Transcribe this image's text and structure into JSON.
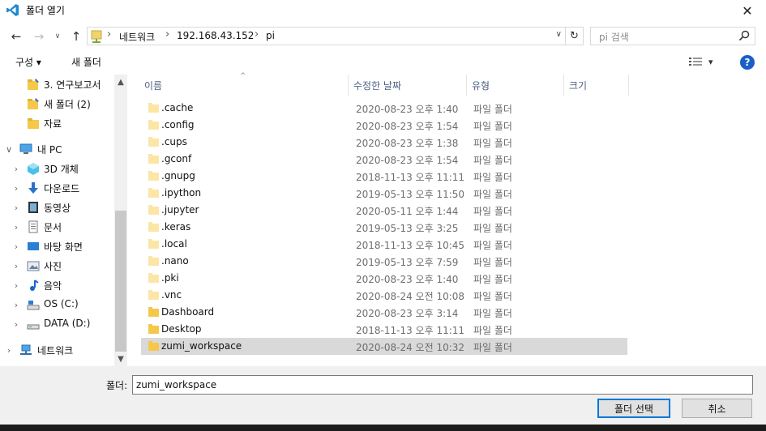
{
  "window": {
    "title": "폴더 열기",
    "close_glyph": "✕"
  },
  "nav": {
    "back_glyph": "←",
    "forward_glyph": "→",
    "recent_glyph": "∨",
    "up_glyph": "↑",
    "breadcrumbs": [
      "네트워크",
      "192.168.43.152",
      "pi"
    ],
    "separator": "›",
    "dropdown_glyph": "∨",
    "refresh_glyph": "↻",
    "search_placeholder": "pi 검색"
  },
  "toolbar": {
    "organize": "구성 ▾",
    "new_folder": "새 폴더",
    "view_glyph": "▾",
    "help": "?"
  },
  "sidebar": {
    "items": [
      {
        "label": "3. 연구보고서",
        "icon": "pinned-folder-icon",
        "level": 1,
        "chevron": ""
      },
      {
        "label": "새 폴더 (2)",
        "icon": "pinned-folder-icon",
        "level": 1,
        "chevron": ""
      },
      {
        "label": "자료",
        "icon": "folder-icon",
        "level": 1,
        "chevron": ""
      },
      {
        "label": "내 PC",
        "icon": "pc-icon",
        "level": 0,
        "chevron": "∨"
      },
      {
        "label": "3D 개체",
        "icon": "3d-objects-icon",
        "level": 1,
        "chevron": "›"
      },
      {
        "label": "다운로드",
        "icon": "download-icon",
        "level": 1,
        "chevron": "›"
      },
      {
        "label": "동영상",
        "icon": "video-icon",
        "level": 1,
        "chevron": "›"
      },
      {
        "label": "문서",
        "icon": "document-icon",
        "level": 1,
        "chevron": "›"
      },
      {
        "label": "바탕 화면",
        "icon": "desktop-icon",
        "level": 1,
        "chevron": "›"
      },
      {
        "label": "사진",
        "icon": "pictures-icon",
        "level": 1,
        "chevron": "›"
      },
      {
        "label": "음악",
        "icon": "music-icon",
        "level": 1,
        "chevron": "›"
      },
      {
        "label": "OS (C:)",
        "icon": "drive-c-icon",
        "level": 1,
        "chevron": "›"
      },
      {
        "label": "DATA (D:)",
        "icon": "drive-d-icon",
        "level": 1,
        "chevron": "›"
      },
      {
        "label": "네트워크",
        "icon": "network-icon",
        "level": 0,
        "chevron": "›"
      }
    ],
    "scroll_up": "▲",
    "scroll_down": "▼"
  },
  "columns": [
    "이름",
    "수정한 날짜",
    "유형",
    "크기"
  ],
  "sort_indicator": "^",
  "files": [
    {
      "name": ".cache",
      "date": "2020-08-23 오후 1:40",
      "type": "파일 폴더",
      "hidden": true
    },
    {
      "name": ".config",
      "date": "2020-08-23 오후 1:54",
      "type": "파일 폴더",
      "hidden": true
    },
    {
      "name": ".cups",
      "date": "2020-08-23 오후 1:38",
      "type": "파일 폴더",
      "hidden": true
    },
    {
      "name": ".gconf",
      "date": "2020-08-23 오후 1:54",
      "type": "파일 폴더",
      "hidden": true
    },
    {
      "name": ".gnupg",
      "date": "2018-11-13 오후 11:11",
      "type": "파일 폴더",
      "hidden": true
    },
    {
      "name": ".ipython",
      "date": "2019-05-13 오후 11:50",
      "type": "파일 폴더",
      "hidden": true
    },
    {
      "name": ".jupyter",
      "date": "2020-05-11 오후 1:44",
      "type": "파일 폴더",
      "hidden": true
    },
    {
      "name": ".keras",
      "date": "2019-05-13 오후 3:25",
      "type": "파일 폴더",
      "hidden": true
    },
    {
      "name": ".local",
      "date": "2018-11-13 오후 10:45",
      "type": "파일 폴더",
      "hidden": true
    },
    {
      "name": ".nano",
      "date": "2019-05-13 오후 7:59",
      "type": "파일 폴더",
      "hidden": true
    },
    {
      "name": ".pki",
      "date": "2020-08-23 오후 1:40",
      "type": "파일 폴더",
      "hidden": true
    },
    {
      "name": ".vnc",
      "date": "2020-08-24 오전 10:08",
      "type": "파일 폴더",
      "hidden": true
    },
    {
      "name": "Dashboard",
      "date": "2020-08-23 오후 3:14",
      "type": "파일 폴더",
      "hidden": false
    },
    {
      "name": "Desktop",
      "date": "2018-11-13 오후 11:11",
      "type": "파일 폴더",
      "hidden": false
    },
    {
      "name": "zumi_workspace",
      "date": "2020-08-24 오전 10:32",
      "type": "파일 폴더",
      "hidden": false,
      "selected": true
    }
  ],
  "bottom": {
    "folder_label": "폴더:",
    "folder_value": "zumi_workspace",
    "select_button": "폴더 선택",
    "cancel_button": "취소"
  },
  "colors": {
    "folder": "#f5c84a",
    "folder_hidden": "#fbe6a6",
    "selected_row": "#d9d9d9",
    "accent": "#0078d7",
    "help": "#1a5fc8"
  }
}
